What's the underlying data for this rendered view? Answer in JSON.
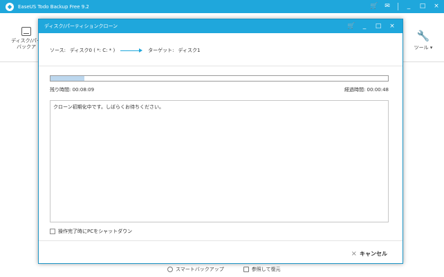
{
  "app": {
    "title": "EaseUS Todo Backup Free 9.2",
    "controls": {
      "cart": "🛒",
      "feedback": "✉",
      "minimize": "_",
      "maximize": "□",
      "close": "×"
    }
  },
  "toolbar": {
    "left_label_line1": "ディスク/パー",
    "left_label_line2": "バックア",
    "tools_icon": "🔧",
    "tools_label": "ツール ▾"
  },
  "bottom_links": {
    "smart_backup": "スマートバックアップ",
    "browse_restore": "参照して復元"
  },
  "dialog": {
    "title": "ディスク/パーティションクローン",
    "controls": {
      "cart": "🛒",
      "minimize": "_",
      "maximize": "□",
      "close": "×"
    },
    "source_label": "ソース:",
    "source_value": "ディスク0 ( *: C: * )",
    "target_label": "ターゲット:",
    "target_value": "ディスク1",
    "progress": {
      "fraction": 0.1
    },
    "remaining_time_label": "残り時間:",
    "remaining_time_value": "00:08:09",
    "elapsed_time_label": "経過時間:",
    "elapsed_time_value": "00:00:48",
    "log_text": "クローン初期化中です。しばらくお待ちください。",
    "shutdown_label": "操作完了時にPCをシャットダウン",
    "cancel_label": "キャンセル",
    "cancel_icon": "×"
  }
}
